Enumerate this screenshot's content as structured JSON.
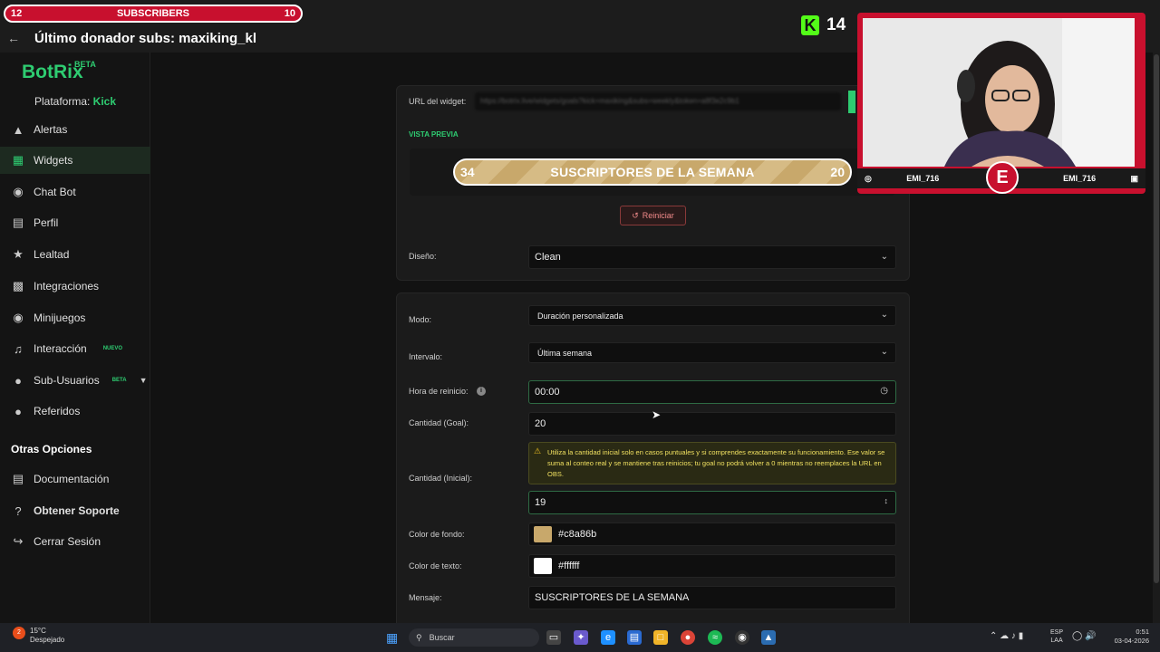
{
  "overlay": {
    "ticker_text": "Último donador subs: maxiking_kl",
    "sub_banner": {
      "left": "12",
      "label": "SUBSCRIBERS",
      "right": "10"
    },
    "kick_count": "14"
  },
  "sidebar": {
    "logo": "BotRix",
    "logo_badge": "BETA",
    "platform_label": "Plataforma:",
    "platform_name": "Kick",
    "items": [
      {
        "label": "Alertas",
        "icon": "warning-icon"
      },
      {
        "label": "Widgets",
        "icon": "widgets-icon"
      },
      {
        "label": "Chat Bot",
        "icon": "robot-icon"
      },
      {
        "label": "Perfil",
        "icon": "profile-card-icon"
      },
      {
        "label": "Lealtad",
        "icon": "trophy-icon"
      },
      {
        "label": "Integraciones",
        "icon": "integrations-icon"
      },
      {
        "label": "Minijuegos",
        "icon": "gamepad-icon"
      },
      {
        "label": "Interacción",
        "icon": "music-note-icon",
        "badge": "NUEVO"
      },
      {
        "label": "Sub-Usuarios",
        "icon": "users-icon",
        "badge": "BETA"
      },
      {
        "label": "Referidos",
        "icon": "referrals-icon"
      }
    ],
    "other_heading": "Otras Opciones",
    "other_items": [
      {
        "label": "Documentación",
        "icon": "document-icon"
      },
      {
        "label": "Obtener Soporte",
        "icon": "help-icon"
      },
      {
        "label": "Cerrar Sesión",
        "icon": "logout-icon"
      }
    ]
  },
  "widget": {
    "url_label": "URL del widget:",
    "url_value": "https://botrix.live/widgets/goals?kick=maxiking&subs=weekly&token=a8f3e2c9b1",
    "preview_label": "VISTA PREVIA",
    "preview": {
      "left": "34",
      "message": "SUSCRIPTORES DE LA SEMANA",
      "right": "20"
    },
    "reset_label": "Reiniciar",
    "design_label": "Diseño:",
    "design_value": "Clean"
  },
  "form": {
    "mode_label": "Modo:",
    "mode_value": "Duración personalizada",
    "interval_label": "Intervalo:",
    "interval_value": "Última semana",
    "reset_time_label": "Hora de reinicio:",
    "reset_time_value": "00:00",
    "goal_label": "Cantidad (Goal):",
    "goal_value": "20",
    "warning_text": "Utiliza la cantidad inicial solo en casos puntuales y si comprendes exactamente su funcionamiento. Ese valor se suma al conteo real y se mantiene tras reinicios; tu goal no podrá volver a 0 mientras no reemplaces la URL en OBS.",
    "initial_label": "Cantidad (Inicial):",
    "initial_value": "19",
    "bg_color_label": "Color de fondo:",
    "bg_color_value": "#c8a86b",
    "text_color_label": "Color de texto:",
    "text_color_value": "#ffffff",
    "message_label": "Mensaje:",
    "message_value": "SUSCRIPTORES DE LA SEMANA"
  },
  "cam": {
    "left_handle": "EMI_716",
    "right_handle": "EMI_716"
  },
  "taskbar": {
    "temp": "15°C",
    "weather": "Despejado",
    "search_placeholder": "Buscar",
    "lang_top": "ESP",
    "lang_bottom": "LAA",
    "time": "0:51",
    "date": "03-04-2026"
  },
  "colors": {
    "accent": "#2ecc71",
    "kick": "#53fc18",
    "brand_red": "#c8102e",
    "goal_bg": "#c8a86b",
    "goal_text": "#ffffff"
  }
}
